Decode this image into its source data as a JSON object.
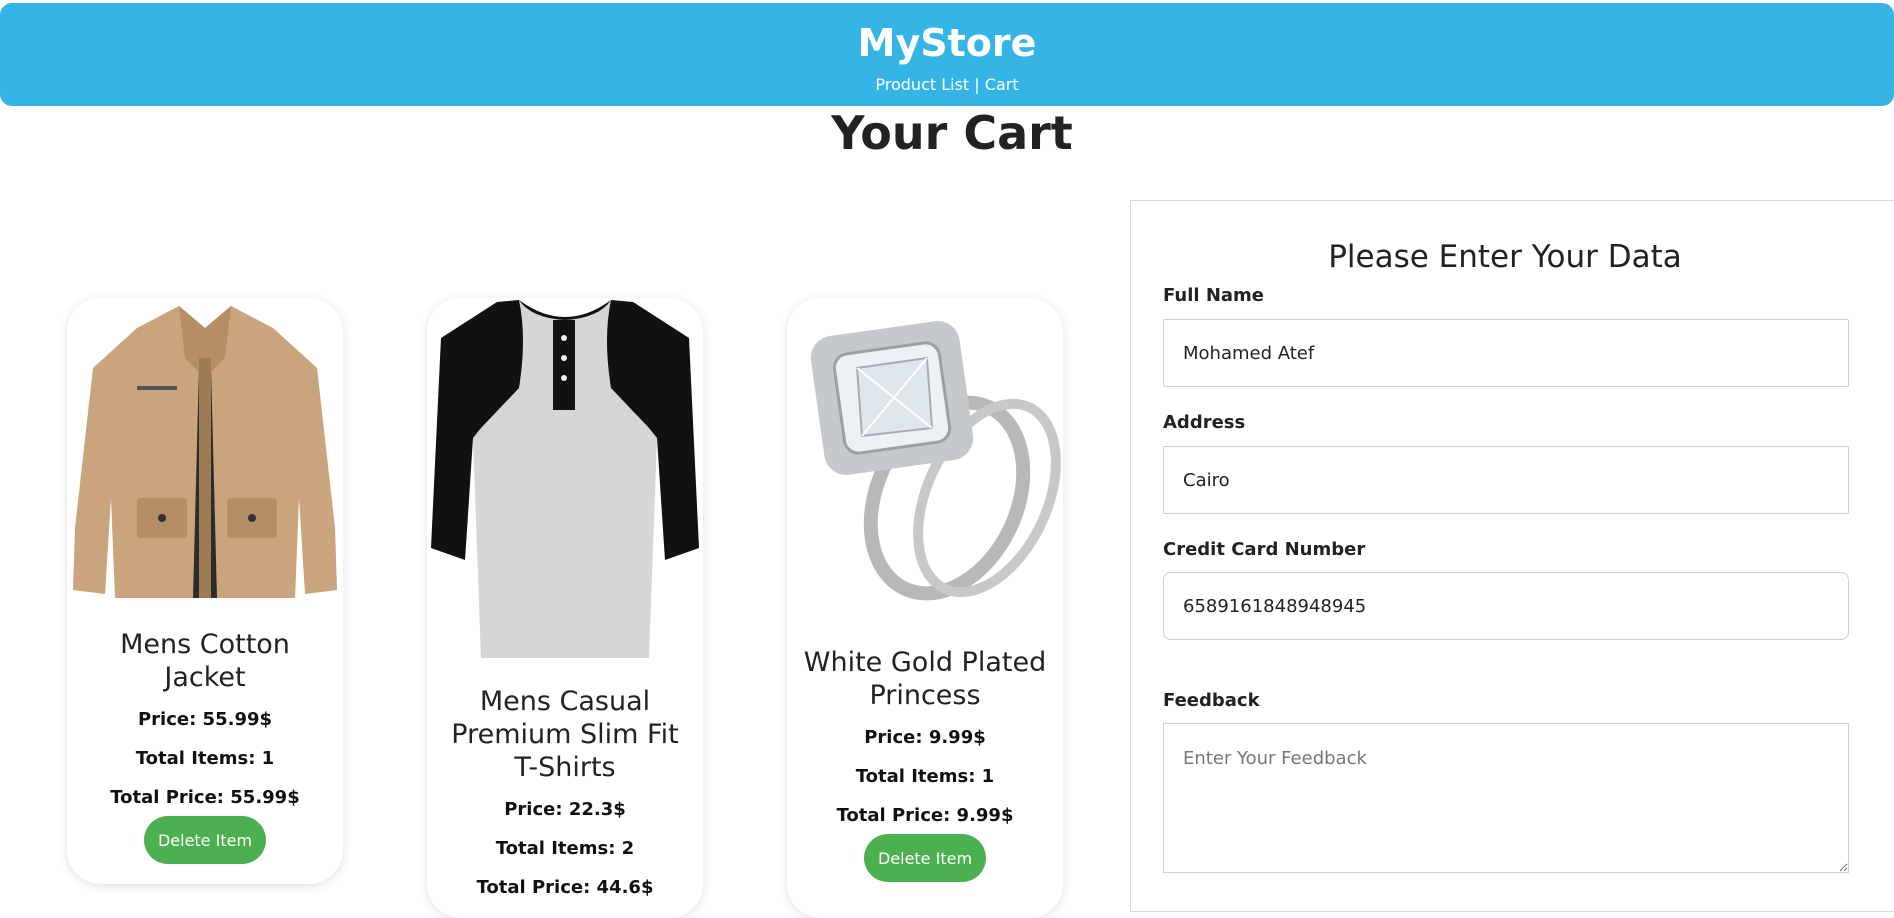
{
  "header": {
    "brand": "MyStore",
    "nav_product_list": "Product List",
    "nav_separator": " | ",
    "nav_cart": "Cart"
  },
  "page_title": "Your Cart",
  "products": [
    {
      "name": "Mens Cotton Jacket",
      "price": "Price: 55.99$",
      "total_items": "Total Items: 1",
      "total_price": "Total Price: 55.99$",
      "delete_label": "Delete Item",
      "image_icon": "jacket-image"
    },
    {
      "name": "Mens Casual Premium Slim Fit T-Shirts",
      "price": "Price: 22.3$",
      "total_items": "Total Items: 2",
      "total_price": "Total Price: 44.6$",
      "image_icon": "tshirt-image"
    },
    {
      "name": "White Gold Plated Princess",
      "price": "Price: 9.99$",
      "total_items": "Total Items: 1",
      "total_price": "Total Price: 9.99$",
      "delete_label": "Delete Item",
      "image_icon": "ring-image"
    }
  ],
  "form": {
    "title": "Please Enter Your Data",
    "full_name_label": "Full Name",
    "full_name_value": "Mohamed Atef",
    "address_label": "Address",
    "address_value": "Cairo",
    "card_label": "Credit Card Number",
    "card_value": "6589161848948945",
    "feedback_label": "Feedback",
    "feedback_placeholder": "Enter Your Feedback"
  },
  "colors": {
    "header_bg": "#35b4e6",
    "button_bg": "#4caf50"
  }
}
